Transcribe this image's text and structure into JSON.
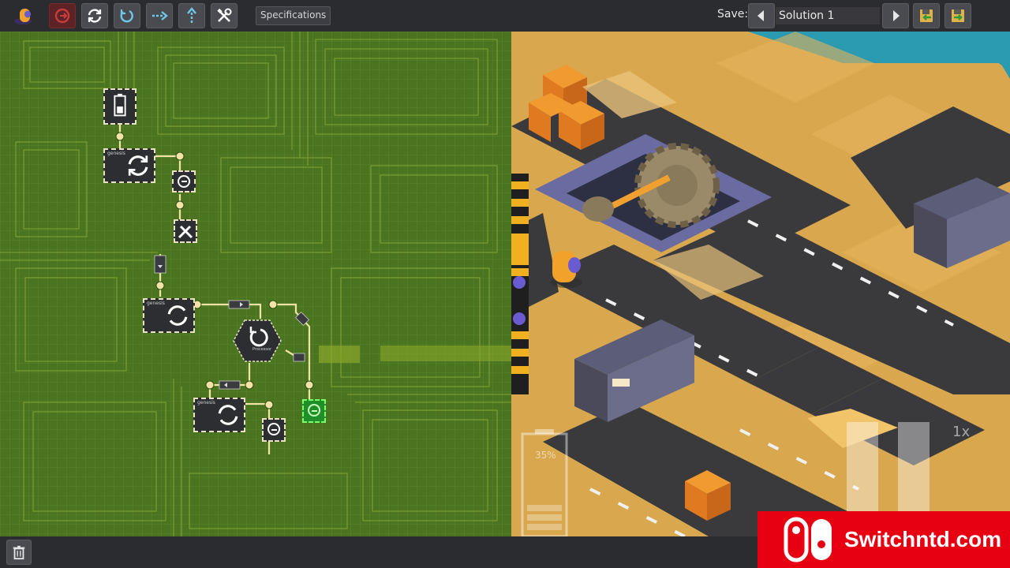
{
  "toolbar": {
    "icons": [
      "robot-logo-icon",
      "power-icon",
      "reload-icon",
      "rotate-icon",
      "move-right-icon",
      "move-up-icon",
      "tools-icon"
    ],
    "specifications_label": "Specifications"
  },
  "save": {
    "label": "Save:",
    "solution_name": "Solution 1"
  },
  "hud": {
    "battery_percent": "35%",
    "speed": "1x"
  },
  "chip": {
    "brand": "genesis",
    "processor_label": "Processor"
  },
  "watermark": {
    "text": "Switchntd.com"
  },
  "colors": {
    "board_green": "#4f7a22",
    "sand": "#d9a84e",
    "road": "#3a3a3d",
    "water": "#2a9bb0",
    "accent_red": "#e60012",
    "toolbar_bg": "#2b2c30"
  }
}
